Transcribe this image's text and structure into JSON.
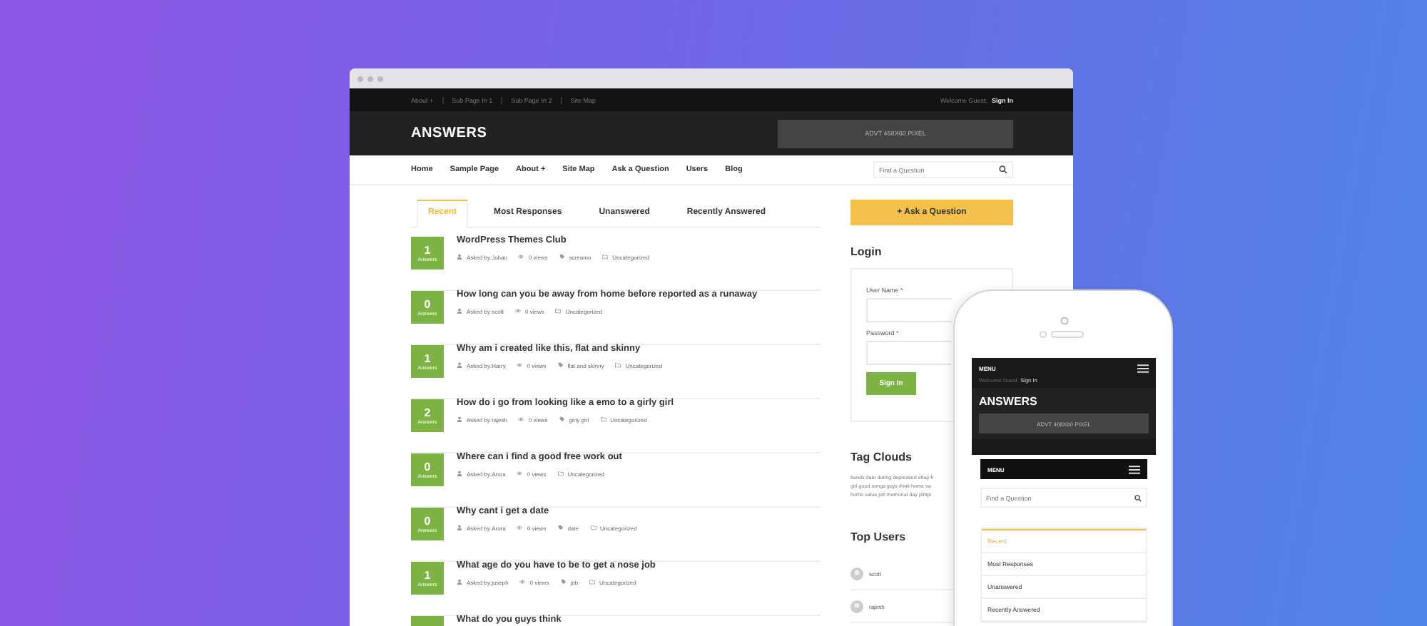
{
  "top_bar": {
    "links": [
      "About +",
      "Sub Page In 1",
      "Sub Page In 2",
      "Site Map"
    ],
    "welcome": "Welcome Guest,",
    "sign_in": "Sign In"
  },
  "header": {
    "logo": "ANSWERS",
    "ad": "ADVT 468X60 PIXEL"
  },
  "nav": {
    "items": [
      "Home",
      "Sample Page",
      "About +",
      "Site Map",
      "Ask a Question",
      "Users",
      "Blog"
    ],
    "search": {
      "placeholder": "Find a Question"
    }
  },
  "tabs": [
    {
      "label": "Recent",
      "selected": true
    },
    {
      "label": "Most Responses",
      "selected": false
    },
    {
      "label": "Unanswered",
      "selected": false
    },
    {
      "label": "Recently Answered",
      "selected": false
    }
  ],
  "questions": [
    {
      "count": "1",
      "count_label": "Answers",
      "title": "WordPress Themes Club",
      "asked_by": "Asked by:Johan",
      "views": "0 views",
      "tag": "screamo",
      "category": "Uncategorized"
    },
    {
      "count": "0",
      "count_label": "Answers",
      "title": "How long can you be away from home before reported as a runaway",
      "asked_by": "Asked by:scott",
      "views": "0 views",
      "category": "Uncategorized"
    },
    {
      "count": "1",
      "count_label": "Answers",
      "title": "Why am i created like this, flat and skinny",
      "asked_by": "Asked by:Harry",
      "views": "0 views",
      "tag": "flat and skinny",
      "category": "Uncategorized"
    },
    {
      "count": "2",
      "count_label": "Answers",
      "title": "How do i go from looking like a emo to a girly girl",
      "asked_by": "Asked by:rajesh",
      "views": "0 views",
      "tag": "girly girl",
      "category": "Uncategorized"
    },
    {
      "count": "0",
      "count_label": "Answers",
      "title": "Where can i find a good free work out",
      "asked_by": "Asked by:Arora",
      "views": "0 views",
      "category": "Uncategorized"
    },
    {
      "count": "0",
      "count_label": "Answers",
      "title": "Why cant i get a date",
      "asked_by": "Asked by:Arora",
      "views": "0 views",
      "tag": "date",
      "category": "Uncategorized"
    },
    {
      "count": "1",
      "count_label": "Answers",
      "title": "What age do you have to be to get a nose job",
      "asked_by": "Asked by:joseph",
      "views": "0 views",
      "tag": "job",
      "category": "Uncategorized"
    },
    {
      "title": "What do you guys think"
    }
  ],
  "sidebar": {
    "ask_button": "+ Ask a Question",
    "login": {
      "title": "Login",
      "fields": [
        {
          "label": "User Name",
          "required_mark": "*"
        },
        {
          "label": "Password",
          "required_mark": "*"
        }
      ],
      "button": "Sign In"
    },
    "tag_cloud": {
      "title": "Tag Clouds",
      "lines": [
        "bands date dating depressed ebay fi",
        "girl good songs guys think home va",
        "home value job memorial day pimpi"
      ]
    },
    "top_users": {
      "title": "Top Users",
      "users": [
        "scott",
        "rajesh"
      ]
    }
  },
  "phone": {
    "menu": "MENU",
    "welcome": "Welcome Guest,",
    "sign_in": "Sign In",
    "logo": "ANSWERS",
    "ad": "ADVT 468X60 PIXEL",
    "menu_bar": "MENU",
    "search": {
      "placeholder": "Find a Question"
    },
    "tabs": [
      {
        "label": "Recent",
        "selected": true
      },
      {
        "label": "Most Responses",
        "selected": false
      },
      {
        "label": "Unanswered",
        "selected": false
      },
      {
        "label": "Recently Answered",
        "selected": false
      }
    ]
  }
}
